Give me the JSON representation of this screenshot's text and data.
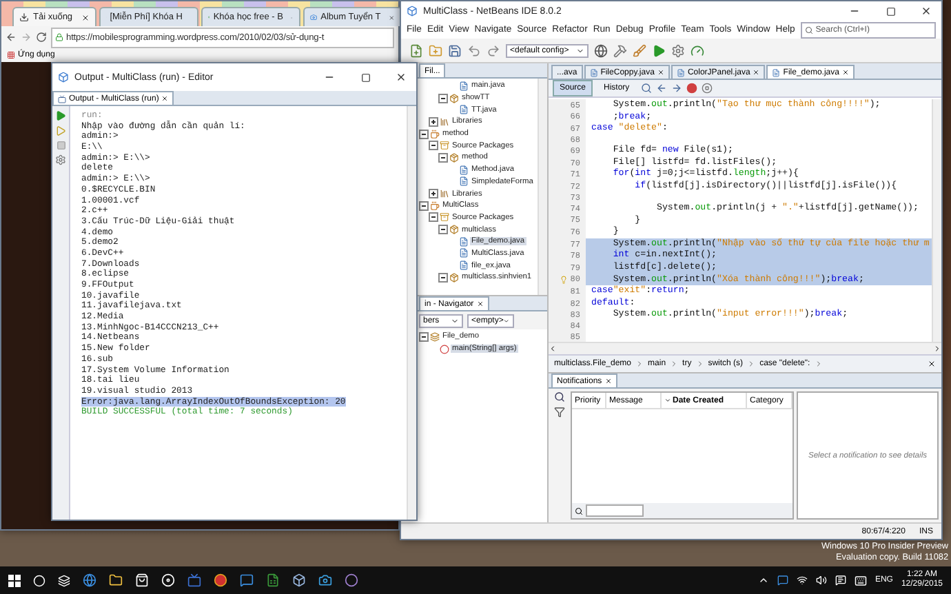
{
  "browser": {
    "tabs": [
      {
        "label": "Tải xuống",
        "kind": "download",
        "selected": true
      },
      {
        "label": "[Miễn Phí] Khóa H",
        "kind": "site",
        "selected": false
      },
      {
        "label": "Khóa học free - B",
        "kind": "site",
        "selected": false
      },
      {
        "label": "Album Tuyển T",
        "kind": "album",
        "selected": false
      }
    ],
    "url": "https://mobilesprogramming.wordpress.com/2010/02/03/sử-dụng-t",
    "bookmarks": [
      "Ứng dụng"
    ]
  },
  "output_window": {
    "title": "Output - MultiClass (run) - Editor",
    "tab": "Output - MultiClass (run)",
    "lines": [
      {
        "text": "run:",
        "kind": "dim"
      },
      {
        "text": "Nhập vào đường dẫn cần quản lí:",
        "kind": "normal"
      },
      {
        "text": "admin:>",
        "kind": "normal"
      },
      {
        "text": "E:\\\\",
        "kind": "normal"
      },
      {
        "text": "admin:> E:\\\\>",
        "kind": "normal"
      },
      {
        "text": "delete",
        "kind": "normal"
      },
      {
        "text": "admin:> E:\\\\>",
        "kind": "normal"
      },
      {
        "text": "0.$RECYCLE.BIN",
        "kind": "normal"
      },
      {
        "text": "1.00001.vcf",
        "kind": "normal"
      },
      {
        "text": "2.c++",
        "kind": "normal"
      },
      {
        "text": "3.Cấu Trúc-Dữ Liệu-Giải thuật",
        "kind": "normal"
      },
      {
        "text": "4.demo",
        "kind": "normal"
      },
      {
        "text": "5.demo2",
        "kind": "normal"
      },
      {
        "text": "6.DevC++",
        "kind": "normal"
      },
      {
        "text": "7.Downloads",
        "kind": "normal"
      },
      {
        "text": "8.eclipse",
        "kind": "normal"
      },
      {
        "text": "9.FFOutput",
        "kind": "normal"
      },
      {
        "text": "10.javafile",
        "kind": "normal"
      },
      {
        "text": "11.javafilejava.txt",
        "kind": "normal"
      },
      {
        "text": "12.Media",
        "kind": "normal"
      },
      {
        "text": "13.MinhNgoc-B14CCCN213_C++",
        "kind": "normal"
      },
      {
        "text": "14.Netbeans",
        "kind": "normal"
      },
      {
        "text": "15.New folder",
        "kind": "normal"
      },
      {
        "text": "16.sub",
        "kind": "normal"
      },
      {
        "text": "17.System Volume Information",
        "kind": "normal"
      },
      {
        "text": "18.tai lieu",
        "kind": "normal"
      },
      {
        "text": "19.visual studio 2013",
        "kind": "normal"
      },
      {
        "text": "Error:java.lang.ArrayIndexOutOfBoundsException: 20",
        "kind": "error"
      },
      {
        "text": "BUILD SUCCESSFUL (total time: 7 seconds)",
        "kind": "success"
      }
    ]
  },
  "ide": {
    "title": "MultiClass - NetBeans IDE 8.0.2",
    "menu": [
      "File",
      "Edit",
      "View",
      "Navigate",
      "Source",
      "Refactor",
      "Run",
      "Debug",
      "Profile",
      "Team",
      "Tools",
      "Window",
      "Help"
    ],
    "search": {
      "placeholder": "Search (Ctrl+I)"
    },
    "config": "<default config>",
    "projects": {
      "tab": "Fil...",
      "tree": [
        {
          "kind": "project",
          "children": [
            {
              "kind": "folder",
              "children": [
                {
                  "kind": "package",
                  "children": [
                    {
                      "label": "main.java",
                      "kind": "file",
                      "selected": false
                    }
                  ]
                },
                {
                  "label": "showTT",
                  "kind": "package",
                  "expanded": true,
                  "selected": false,
                  "children": [
                    {
                      "label": "TT.java",
                      "kind": "file",
                      "selected": false
                    }
                  ]
                }
              ]
            },
            {
              "label": "Libraries",
              "kind": "library",
              "expanded": false,
              "selected": false
            }
          ]
        },
        {
          "label": "method",
          "kind": "project",
          "expanded": true,
          "selected": false,
          "children": [
            {
              "label": "Source Packages",
              "kind": "folder",
              "expanded": true,
              "selected": false,
              "children": [
                {
                  "label": "method",
                  "kind": "package",
                  "expanded": true,
                  "selected": false,
                  "children": [
                    {
                      "label": "Method.java",
                      "kind": "file",
                      "selected": false
                    },
                    {
                      "label": "SimpledateForma",
                      "kind": "file",
                      "selected": false
                    }
                  ]
                }
              ]
            },
            {
              "label": "Libraries",
              "kind": "library",
              "expanded": false,
              "selected": false
            }
          ]
        },
        {
          "label": "MultiClass",
          "kind": "project",
          "expanded": true,
          "selected": false,
          "children": [
            {
              "label": "Source Packages",
              "kind": "folder",
              "expanded": true,
              "selected": false,
              "children": [
                {
                  "label": "multiclass",
                  "kind": "package",
                  "expanded": true,
                  "selected": false,
                  "children": [
                    {
                      "label": "File_demo.java",
                      "kind": "file",
                      "selected": true
                    },
                    {
                      "label": "MultiClass.java",
                      "kind": "file",
                      "selected": false
                    },
                    {
                      "label": "file_ex.java",
                      "kind": "file",
                      "selected": false
                    }
                  ]
                },
                {
                  "label": "multiclass.sinhvien1",
                  "kind": "package",
                  "expanded": true,
                  "selected": false
                }
              ]
            }
          ]
        }
      ]
    },
    "navigator": {
      "title": "in - Navigator",
      "filter": "bers",
      "filter_2": "<empty>",
      "tree": [
        {
          "label": "File_demo",
          "kind": "class",
          "expanded": true,
          "selected": false,
          "children": [
            {
              "label": "main(String[] args)",
              "kind": "method",
              "selected": true
            }
          ]
        }
      ]
    },
    "editor_tabs": [
      {
        "label": "...ava",
        "selected": false,
        "closable": false
      },
      {
        "label": "FileCoppy.java",
        "selected": false,
        "closable": true
      },
      {
        "label": "ColorJPanel.java",
        "selected": false,
        "closable": true
      },
      {
        "label": "File_demo.java",
        "selected": true,
        "closable": true
      }
    ],
    "view_tabs": [
      {
        "label": "Source",
        "selected": true
      },
      {
        "label": "History",
        "selected": false
      }
    ],
    "code": [
      {
        "number": "65",
        "highlighted": false,
        "hint": false,
        "tokens": [
          {
            "kind": "plain",
            "text": "    System."
          },
          {
            "kind": "field",
            "text": "out"
          },
          {
            "kind": "plain",
            "text": ".println("
          },
          {
            "kind": "string",
            "text": "\"Tạo thư mục thành công!!!!\""
          },
          {
            "kind": "plain",
            "text": ");"
          }
        ]
      },
      {
        "number": "66",
        "highlighted": false,
        "hint": false,
        "tokens": [
          {
            "kind": "plain",
            "text": "    ;"
          },
          {
            "kind": "keyword",
            "text": "break"
          },
          {
            "kind": "plain",
            "text": ";"
          }
        ]
      },
      {
        "number": "67",
        "highlighted": false,
        "hint": false,
        "tokens": [
          {
            "kind": "keyword",
            "text": "case "
          },
          {
            "kind": "string",
            "text": "\"delete\""
          },
          {
            "kind": "plain",
            "text": ":"
          }
        ]
      },
      {
        "number": "68",
        "hint": false
      },
      {
        "number": "69",
        "highlighted": false,
        "hint": false,
        "tokens": [
          {
            "kind": "plain",
            "text": "    File fd= "
          },
          {
            "kind": "keyword",
            "text": "new"
          },
          {
            "kind": "plain",
            "text": " File(s1);"
          }
        ]
      },
      {
        "number": "70",
        "highlighted": false,
        "hint": false,
        "tokens": [
          {
            "kind": "plain",
            "text": "    File[] listfd= fd.listFiles();"
          }
        ]
      },
      {
        "number": "71",
        "highlighted": false,
        "hint": false,
        "tokens": [
          {
            "kind": "keyword",
            "text": "    for"
          },
          {
            "kind": "plain",
            "text": "("
          },
          {
            "kind": "keyword",
            "text": "int"
          },
          {
            "kind": "plain",
            "text": " j=0;j<=listfd."
          },
          {
            "kind": "field",
            "text": "length"
          },
          {
            "kind": "plain",
            "text": ";j++){"
          }
        ]
      },
      {
        "number": "72",
        "highlighted": false,
        "hint": false,
        "tokens": [
          {
            "kind": "keyword",
            "text": "        if"
          },
          {
            "kind": "plain",
            "text": "(listfd[j].isDirectory()||listfd[j].isFile()){"
          }
        ]
      },
      {
        "number": "73",
        "hint": false
      },
      {
        "number": "74",
        "highlighted": false,
        "hint": false,
        "tokens": [
          {
            "kind": "plain",
            "text": "            System."
          },
          {
            "kind": "field",
            "text": "out"
          },
          {
            "kind": "plain",
            "text": ".println(j + "
          },
          {
            "kind": "string",
            "text": "\".\""
          },
          {
            "kind": "plain",
            "text": "+listfd[j].getName());"
          }
        ]
      },
      {
        "number": "75",
        "highlighted": false,
        "hint": false,
        "tokens": [
          {
            "kind": "plain",
            "text": "        }"
          }
        ]
      },
      {
        "number": "76",
        "highlighted": false,
        "hint": false,
        "tokens": [
          {
            "kind": "plain",
            "text": "    }"
          }
        ]
      },
      {
        "number": "77",
        "highlighted": true,
        "hint": false,
        "tokens": [
          {
            "kind": "plain",
            "text": "    System."
          },
          {
            "kind": "field",
            "text": "out"
          },
          {
            "kind": "plain",
            "text": ".println("
          },
          {
            "kind": "string",
            "text": "\"Nhập vào số thứ tự của file hoặc thư m"
          }
        ]
      },
      {
        "number": "78",
        "highlighted": true,
        "hint": false,
        "tokens": [
          {
            "kind": "keyword",
            "text": "    int"
          },
          {
            "kind": "plain",
            "text": " c=in.nextInt();"
          }
        ]
      },
      {
        "number": "79",
        "highlighted": true,
        "hint": false,
        "tokens": [
          {
            "kind": "plain",
            "text": "    listfd[c].delete();"
          }
        ]
      },
      {
        "number": "80",
        "highlighted": true,
        "hint": true,
        "tokens": [
          {
            "kind": "plain",
            "text": "    System."
          },
          {
            "kind": "field",
            "text": "out"
          },
          {
            "kind": "plain",
            "text": ".println("
          },
          {
            "kind": "string",
            "text": "\"Xóa thành công!!!\""
          },
          {
            "kind": "plain",
            "text": ");"
          },
          {
            "kind": "keyword",
            "text": "break"
          },
          {
            "kind": "plain",
            "text": ";"
          }
        ]
      },
      {
        "number": "81",
        "highlighted": false,
        "hint": false,
        "tokens": [
          {
            "kind": "keyword",
            "text": "case"
          },
          {
            "kind": "string",
            "text": "\"exit\""
          },
          {
            "kind": "plain",
            "text": ":"
          },
          {
            "kind": "keyword",
            "text": "return"
          },
          {
            "kind": "plain",
            "text": ";"
          }
        ]
      },
      {
        "number": "82",
        "highlighted": false,
        "hint": false,
        "tokens": [
          {
            "kind": "keyword",
            "text": "default"
          },
          {
            "kind": "plain",
            "text": ":"
          }
        ]
      },
      {
        "number": "83",
        "highlighted": false,
        "hint": false,
        "tokens": [
          {
            "kind": "plain",
            "text": "    System."
          },
          {
            "kind": "field",
            "text": "out"
          },
          {
            "kind": "plain",
            "text": ".println("
          },
          {
            "kind": "string",
            "text": "\"input error!!!\""
          },
          {
            "kind": "plain",
            "text": ");"
          },
          {
            "kind": "keyword",
            "text": "break"
          },
          {
            "kind": "plain",
            "text": ";"
          }
        ]
      },
      {
        "number": "84",
        "hint": false
      },
      {
        "number": "85",
        "hint": false
      }
    ],
    "breadcrumb": [
      "multiclass.File_demo",
      "main",
      "try",
      "switch (s)",
      "case \"delete\":"
    ],
    "notifications": {
      "tab": "Notifications",
      "columns": [
        {
          "label": "Priority",
          "sorted": false
        },
        {
          "label": "Message",
          "sorted": false
        },
        {
          "label": "Date Created",
          "sorted": true
        },
        {
          "label": "Category",
          "sorted": false
        }
      ],
      "detail": "Select a notification to see details"
    },
    "status": {
      "position": "80:67/4:220",
      "mode": "INS"
    }
  },
  "desktop": {
    "watermark": [
      "Windows 10 Pro Insider Preview",
      "Evaluation copy. Build 11082"
    ]
  },
  "taskbar": {
    "language": "ENG",
    "time": "1:22 AM",
    "date": "12/29/2015"
  }
}
